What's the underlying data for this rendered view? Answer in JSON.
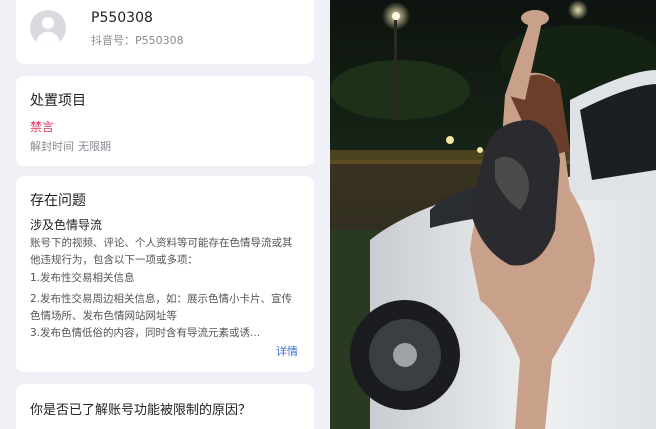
{
  "account": {
    "username": "P550308",
    "douyin_id": "抖音号：P550308"
  },
  "penalty": {
    "title": "处置项目",
    "action": "禁言",
    "unlock_label": "解封时间",
    "unlock_value": "无限期"
  },
  "issue": {
    "title": "存在问题",
    "subtitle": "涉及色情导流",
    "description": "账号下的视频、评论、个人资料等可能存在色情导流或其他违规行为，包含以下一项或多项：",
    "items": [
      "1.发布性交易相关信息",
      "2.发布性交易周边相关信息，如：展示色情小卡片、宣传色情场所、发布色情网站网址等",
      "3.发布色情低俗的内容，同时含有导流元素或诱..."
    ],
    "more_link": "详情"
  },
  "question": {
    "title": "你是否已了解账号功能被限制的原因？"
  },
  "icons": {
    "avatar": "default-avatar-icon"
  },
  "colors": {
    "page_bg": "#f0f1f6",
    "ban_red": "#e0305a",
    "link_blue": "#3a6fd8"
  }
}
